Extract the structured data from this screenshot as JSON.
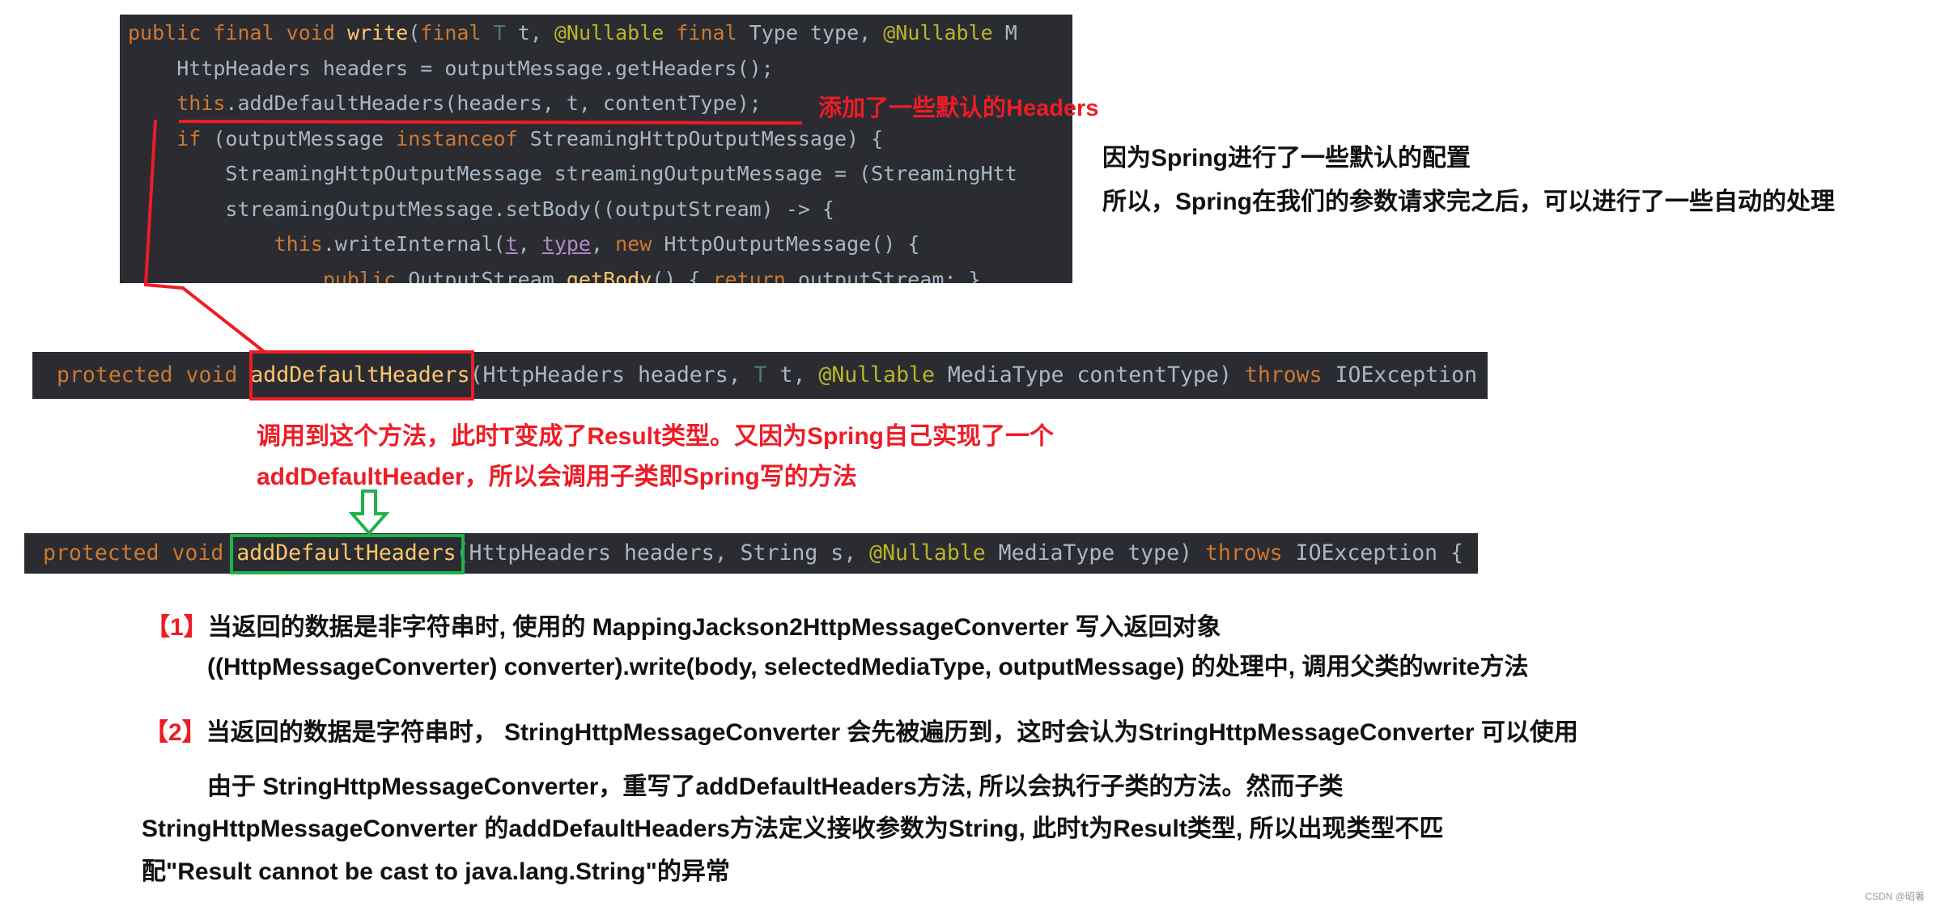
{
  "colors": {
    "code_bg": "#2a2c31",
    "keyword": "#cc7832",
    "method": "#ffc66d",
    "annotation": "#bbb529",
    "annotation_red": "#ee1c25",
    "highlight_green": "#22b14c"
  },
  "code_block_1": {
    "lines": [
      [
        [
          "kw",
          "public final void "
        ],
        [
          "fn",
          "write"
        ],
        [
          "df",
          "("
        ],
        [
          "kw",
          "final "
        ],
        [
          "tp",
          "T "
        ],
        [
          "df",
          "t, "
        ],
        [
          "an",
          "@Nullable "
        ],
        [
          "kw",
          "final "
        ],
        [
          "df",
          "Type type, "
        ],
        [
          "an",
          "@Nullable "
        ],
        [
          "df",
          "M"
        ]
      ],
      [
        [
          "df",
          "    HttpHeaders headers = outputMessage.getHeaders();"
        ]
      ],
      [
        [
          "kw",
          "    this"
        ],
        [
          "df",
          ".addDefaultHeaders(headers, t, contentType);"
        ]
      ],
      [
        [
          "kw",
          "    if "
        ],
        [
          "df",
          "(outputMessage "
        ],
        [
          "kw",
          "instanceof "
        ],
        [
          "df",
          "StreamingHttpOutputMessage) {"
        ]
      ],
      [
        [
          "df",
          "        StreamingHttpOutputMessage streamingOutputMessage = (StreamingHtt"
        ]
      ],
      [
        [
          "df",
          "        streamingOutputMessage.setBody((outputStream) -> {"
        ]
      ],
      [
        [
          "kw",
          "            this"
        ],
        [
          "df",
          ".writeInternal("
        ],
        [
          "pm",
          "t"
        ],
        [
          "df",
          ", "
        ],
        [
          "pm",
          "type"
        ],
        [
          "df",
          ", "
        ],
        [
          "kw",
          "new "
        ],
        [
          "df",
          "HttpOutputMessage() {"
        ]
      ],
      [
        [
          "kw",
          "                public "
        ],
        [
          "df",
          "OutputStream "
        ],
        [
          "fn",
          "getBody"
        ],
        [
          "df",
          "() { "
        ],
        [
          "kw",
          "return "
        ],
        [
          "df",
          "outputStream; }"
        ]
      ]
    ]
  },
  "annotation_1": "添加了一些默认的Headers",
  "side_note": [
    "因为Spring进行了一些默认的配置",
    "所以，Spring在我们的参数请求完之后，可以进行了一些自动的处理"
  ],
  "code_bar_2": [
    [
      "kw",
      "protected void "
    ],
    [
      "fn",
      "addDefaultHeaders"
    ],
    [
      "df",
      "(HttpHeaders headers, "
    ],
    [
      "tp",
      "T "
    ],
    [
      "df",
      "t, "
    ],
    [
      "an",
      "@Nullable "
    ],
    [
      "df",
      "MediaType contentType) "
    ],
    [
      "kw",
      "throws "
    ],
    [
      "df",
      "IOException"
    ]
  ],
  "annotation_2": [
    "调用到这个方法，此时T变成了Result类型。又因为Spring自己实现了一个",
    "addDefaultHeader，所以会调用子类即Spring写的方法"
  ],
  "code_bar_3": [
    [
      "kw",
      "protected void "
    ],
    [
      "fn",
      "addDefaultHeaders"
    ],
    [
      "df",
      "(HttpHeaders headers, String s, "
    ],
    [
      "an",
      "@Nullable "
    ],
    [
      "df",
      "MediaType type) "
    ],
    [
      "kw",
      "throws "
    ],
    [
      "df",
      "IOException {"
    ]
  ],
  "notes": {
    "n1_marker": "【1】",
    "n1_line1": "当返回的数据是非字符串时, 使用的 MappingJackson2HttpMessageConverter 写入返回对象",
    "n1_line2": "((HttpMessageConverter) converter).write(body, selectedMediaType, outputMessage) 的处理中, 调用父类的write方法",
    "n2_marker": "【2】",
    "n2_line1": "当返回的数据是字符串时， StringHttpMessageConverter 会先被遍历到，这时会认为StringHttpMessageConverter 可以使用",
    "n2_line2": "由于 StringHttpMessageConverter，重写了addDefaultHeaders方法, 所以会执行子类的方法。然而子类",
    "n2_line3": "StringHttpMessageConverter 的addDefaultHeaders方法定义接收参数为String, 此时t为Result类型, 所以出现类型不匹",
    "n2_line4": "配\"Result cannot be cast to java.lang.String\"的异常"
  },
  "watermark": "CSDN @昭著"
}
